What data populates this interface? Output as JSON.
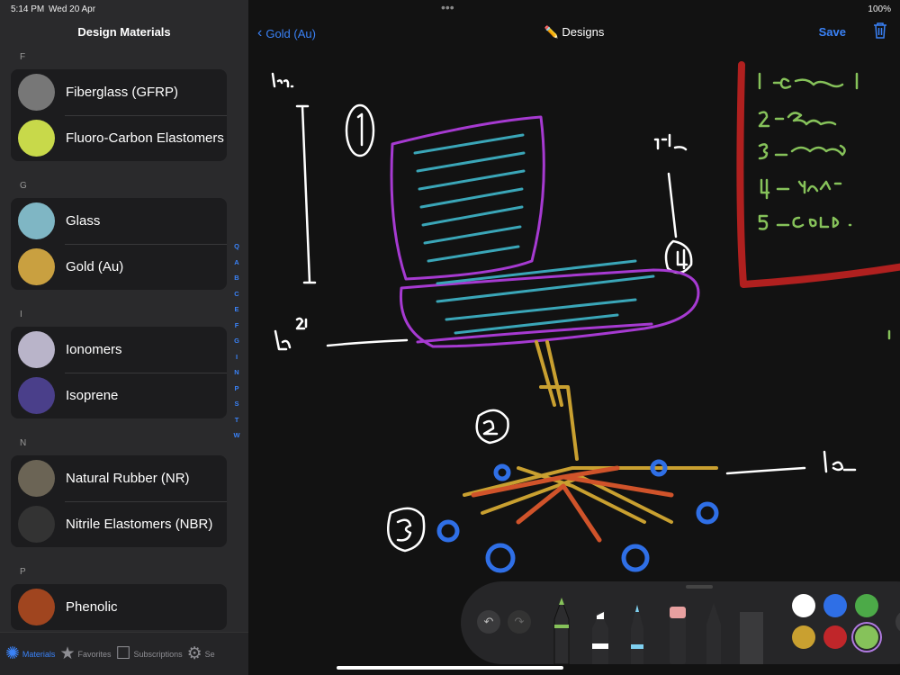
{
  "status": {
    "time": "5:14 PM",
    "date": "Wed 20 Apr",
    "battery": "100%"
  },
  "sidebar": {
    "title": "Design Materials",
    "sections": [
      {
        "letter": "F",
        "items": [
          {
            "label": "Fiberglass (GFRP)",
            "color": "#777"
          },
          {
            "label": "Fluoro-Carbon Elastomers",
            "color": "#c8d94a"
          }
        ]
      },
      {
        "letter": "G",
        "items": [
          {
            "label": "Glass",
            "color": "#7fb6c4"
          },
          {
            "label": "Gold (Au)",
            "color": "#c9a040"
          }
        ]
      },
      {
        "letter": "I",
        "items": [
          {
            "label": "Ionomers",
            "color": "#b9b4c9"
          },
          {
            "label": "Isoprene",
            "color": "#4a3f8a"
          }
        ]
      },
      {
        "letter": "N",
        "items": [
          {
            "label": "Natural Rubber (NR)",
            "color": "#6b6455"
          },
          {
            "label": "Nitrile Elastomers (NBR)",
            "color": "#333"
          }
        ]
      },
      {
        "letter": "P",
        "items": [
          {
            "label": "Phenolic",
            "color": "#a0451f"
          }
        ]
      }
    ],
    "index": [
      "Q",
      "A",
      "B",
      "C",
      "E",
      "F",
      "G",
      "I",
      "N",
      "P",
      "S",
      "T",
      "W"
    ],
    "tabs": [
      {
        "label": "Materials",
        "icon": "materials-icon",
        "active": true
      },
      {
        "label": "Favorites",
        "icon": "star-icon"
      },
      {
        "label": "Subscriptions",
        "icon": "compose-icon"
      },
      {
        "label": "Se",
        "icon": "gear-icon"
      }
    ]
  },
  "header": {
    "back_label": "Gold (Au)",
    "title": "✏️ Designs",
    "save_label": "Save"
  },
  "toolbar": {
    "more_label": "•••",
    "colors": [
      "#ffffff",
      "#2f6fe6",
      "#4caa48",
      "#c9a030",
      "#c0262a",
      "#86c25a"
    ],
    "selected_color": "#86c25a"
  }
}
